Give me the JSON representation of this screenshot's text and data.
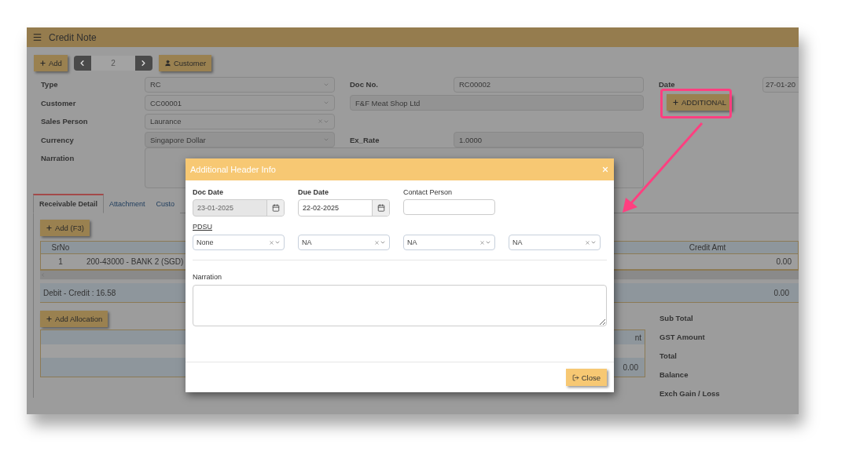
{
  "app": {
    "title": "Credit Note"
  },
  "toolbar": {
    "add": "Add",
    "record": "2",
    "customer": "Customer"
  },
  "header": {
    "type": {
      "label": "Type",
      "value": "RC",
      "clearable": false
    },
    "doc_no": {
      "label": "Doc No.",
      "value": "RC00002"
    },
    "date": {
      "label": "Date",
      "value": "27-01-20"
    },
    "customer": {
      "label": "Customer",
      "value": "CC00001",
      "clearable": false
    },
    "customer_name": {
      "value": "F&F Meat Shop Ltd"
    },
    "additional_button": "ADDITIONAL",
    "sales_person": {
      "label": "Sales Person",
      "value": "Laurance",
      "clearable": true
    },
    "currency": {
      "label": "Currency",
      "value": "Singapore Dollar",
      "clearable": false
    },
    "ex_rate": {
      "label": "Ex_Rate",
      "value": "1.0000"
    },
    "narration": {
      "label": "Narration"
    }
  },
  "tabs": [
    {
      "label": "Receivable Detail",
      "selected": true
    },
    {
      "label": "Attachment",
      "selected": false
    },
    {
      "label": "Custo",
      "selected": false
    }
  ],
  "detail": {
    "add_button": "Add (F3)",
    "srno_header": "SrNo",
    "credit_header": "Credit Amt",
    "rows": [
      {
        "srno": "1",
        "account": "200-43000 - BANK 2 (SGD)",
        "credit": "0.00"
      }
    ],
    "summary": {
      "label": "Debit - Credit : 16.58",
      "credit": "0.00"
    }
  },
  "allocation": {
    "add_button": "Add Allocation",
    "column_header": "nt",
    "total": "0.00"
  },
  "totals": [
    "Sub Total",
    "GST Amount",
    "Total",
    "Balance",
    "Exch Gain / Loss"
  ],
  "dialog": {
    "title": "Additional Header Info",
    "fields": [
      {
        "kind": "date",
        "label": "Doc Date",
        "value": "23-01-2025",
        "disabled": true
      },
      {
        "kind": "date",
        "label": "Due Date",
        "value": "22-02-2025",
        "disabled": false
      },
      {
        "kind": "text",
        "label": "Contact Person",
        "disabled": false
      }
    ],
    "pdsu": {
      "label": "PDSU",
      "selects": [
        "None",
        "NA",
        "NA",
        "NA"
      ]
    },
    "narration": {
      "label": "Narration"
    },
    "close_button": "Close"
  }
}
